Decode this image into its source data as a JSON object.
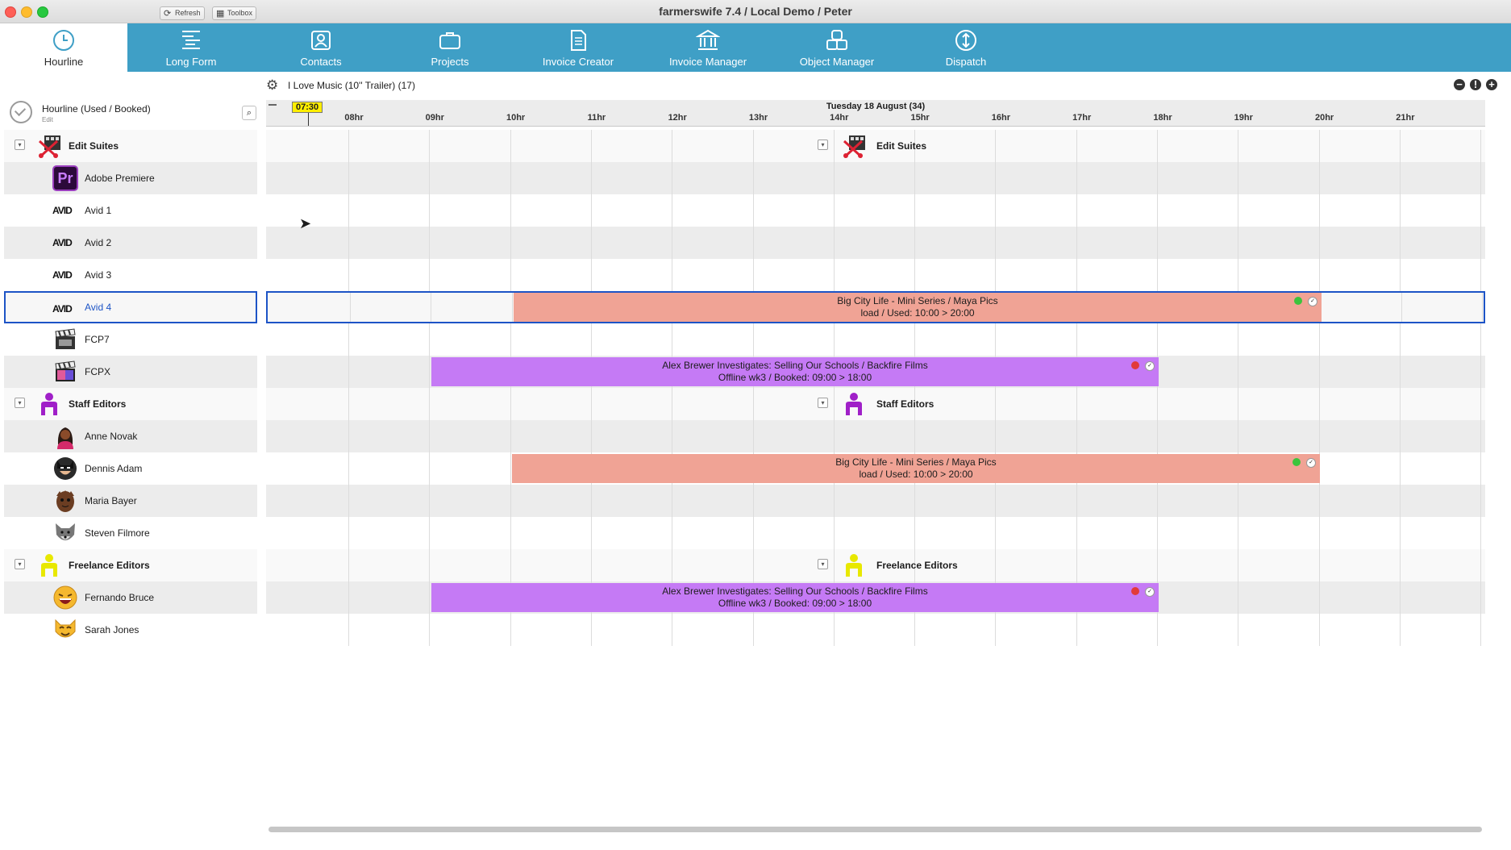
{
  "window": {
    "title": "farmerswife 7.4  / Local Demo / Peter"
  },
  "nav": [
    {
      "label": "Hourline",
      "icon": "clock-icon",
      "active": true
    },
    {
      "label": "Long Form",
      "icon": "long-form-icon"
    },
    {
      "label": "Contacts",
      "icon": "contacts-icon"
    },
    {
      "label": "Projects",
      "icon": "briefcase-icon"
    },
    {
      "label": "Invoice Creator",
      "icon": "document-icon"
    },
    {
      "label": "Invoice Manager",
      "icon": "bank-icon"
    },
    {
      "label": "Object Manager",
      "icon": "objects-icon"
    },
    {
      "label": "Dispatch",
      "icon": "dispatch-icon"
    }
  ],
  "toolbar": {
    "refresh": "Refresh",
    "toolbox": "Toolbox",
    "project": "I Love Music (10'' Trailer) (17)"
  },
  "hourline": {
    "title": "Hourline (Used / Booked)",
    "subtitle": "Edit"
  },
  "timeline": {
    "date": "Tuesday 18 August (34)",
    "now": "07:30",
    "hours": [
      "08hr",
      "09hr",
      "10hr",
      "11hr",
      "12hr",
      "13hr",
      "14hr",
      "15hr",
      "16hr",
      "17hr",
      "18hr",
      "19hr",
      "20hr",
      "21hr"
    ]
  },
  "groups": {
    "edit_suites": "Edit Suites",
    "staff_editors": "Staff Editors",
    "freelance_editors": "Freelance Editors"
  },
  "resources": {
    "adobe_premiere": "Adobe Premiere",
    "pr_badge": "Pr",
    "avid_logo": "AVID",
    "avid1": "Avid 1",
    "avid2": "Avid 2",
    "avid3": "Avid 3",
    "avid4": "Avid 4",
    "fcp7": "FCP7",
    "fcpx": "FCPX",
    "anne": "Anne Novak",
    "dennis": "Dennis Adam",
    "maria": "Maria Bayer",
    "steven": "Steven Filmore",
    "fernando": "Fernando Bruce",
    "sarah": "Sarah Jones"
  },
  "bookings": {
    "big_city": {
      "title": "Big City Life - Mini Series / Maya Pics",
      "detail": "load / Used: 10:00 > 20:00",
      "status": "green"
    },
    "alex": {
      "title": "Alex Brewer Investigates: Selling Our Schools / Backfire Films",
      "detail": "Offline wk3 / Booked: 09:00 > 18:00",
      "status": "red"
    }
  },
  "colors": {
    "nav": "#3f9fc6",
    "selection": "#1d54c6",
    "salmon": "#f0a395",
    "purple": "#c57af5",
    "green": "#3cc43c",
    "red": "#e23a3a"
  }
}
